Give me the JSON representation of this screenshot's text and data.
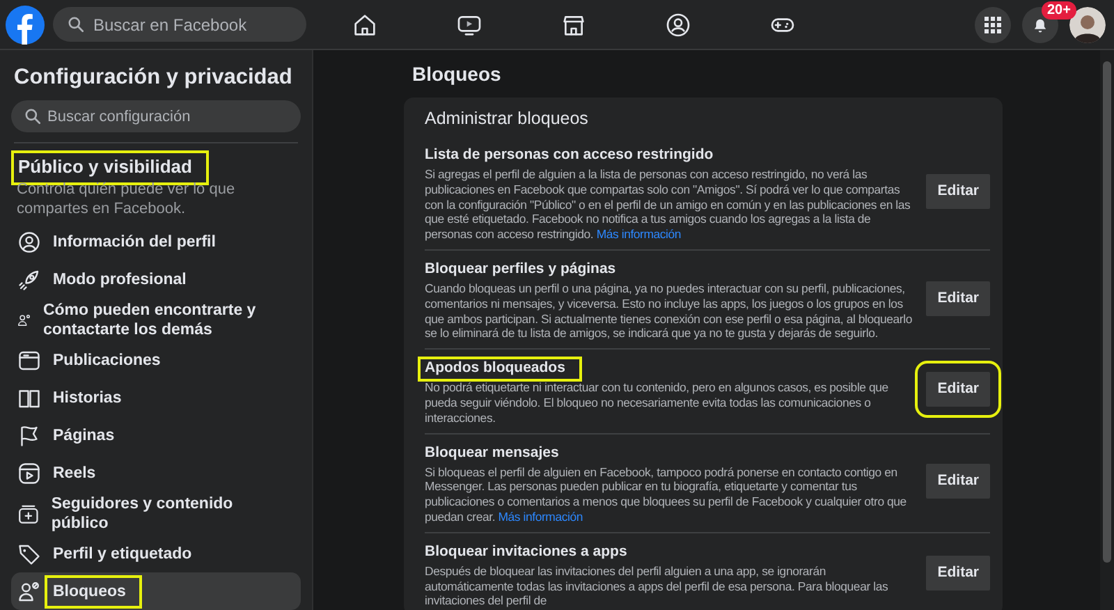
{
  "topbar": {
    "search": {
      "placeholder": "Buscar en Facebook"
    },
    "nav": [
      {
        "kind": "home"
      },
      {
        "kind": "video"
      },
      {
        "kind": "store"
      },
      {
        "kind": "groups"
      },
      {
        "kind": "gaming"
      }
    ],
    "notifications_badge": "20+"
  },
  "sidebar": {
    "title": "Configuración y privacidad",
    "search": {
      "placeholder": "Buscar configuración"
    },
    "section": {
      "title": "Público y visibilidad",
      "highlighted": true,
      "description": "Controla quién puede ver lo que compartes en Facebook."
    },
    "items": [
      {
        "label": "Información del perfil",
        "kind": "profile",
        "selected": false,
        "highlighted": false
      },
      {
        "label": "Modo profesional",
        "kind": "professional",
        "selected": false,
        "highlighted": false
      },
      {
        "label": "Cómo pueden encontrarte y contactarte los demás",
        "kind": "find",
        "selected": false,
        "highlighted": false
      },
      {
        "label": "Publicaciones",
        "kind": "posts",
        "selected": false,
        "highlighted": false
      },
      {
        "label": "Historias",
        "kind": "stories",
        "selected": false,
        "highlighted": false
      },
      {
        "label": "Páginas",
        "kind": "pages",
        "selected": false,
        "highlighted": false
      },
      {
        "label": "Reels",
        "kind": "reels",
        "selected": false,
        "highlighted": false
      },
      {
        "label": "Seguidores y contenido público",
        "kind": "followers",
        "selected": false,
        "highlighted": false
      },
      {
        "label": "Perfil y etiquetado",
        "kind": "tag",
        "selected": false,
        "highlighted": false
      },
      {
        "label": "Bloqueos",
        "kind": "block",
        "selected": true,
        "highlighted": true
      }
    ]
  },
  "main": {
    "title": "Bloqueos",
    "card": {
      "title": "Administrar bloqueos",
      "sections": [
        {
          "title": "Lista de personas con acceso restringido",
          "title_highlighted": false,
          "body": "Si agregas el perfil de alguien a la lista de personas con acceso restringido, no verá las publicaciones en Facebook que compartas solo con \"Amigos\". Sí podrá ver lo que compartas con la configuración \"Público\" o en el perfil de un amigo en común y en las publicaciones en las que esté etiquetado. Facebook no notifica a tus amigos cuando los agregas a la lista de personas con acceso restringido.",
          "link": "Más información",
          "button": "Editar",
          "button_highlighted": false
        },
        {
          "title": "Bloquear perfiles y páginas",
          "title_highlighted": false,
          "body": "Cuando bloqueas un perfil o una página, ya no puedes interactuar con su perfil, publicaciones, comentarios ni mensajes, y viceversa. Esto no incluye las apps, los juegos o los grupos en los que ambos participan. Si actualmente tienes conexión con ese perfil o esa página, al bloquearlo se lo eliminará de tu lista de amigos, se indicará que ya no te gusta y dejarás de seguirlo.",
          "button": "Editar",
          "button_highlighted": false
        },
        {
          "title": "Apodos bloqueados",
          "title_highlighted": true,
          "body": "No podrá etiquetarte ni interactuar con tu contenido, pero en algunos casos, es posible que pueda seguir viéndolo. El bloqueo no necesariamente evita todas las comunicaciones o interacciones.",
          "button": "Editar",
          "button_highlighted": true
        },
        {
          "title": "Bloquear mensajes",
          "title_highlighted": false,
          "body": "Si bloqueas el perfil de alguien en Facebook, tampoco podrá ponerse en contacto contigo en Messenger. Las personas pueden publicar en tu biografía, etiquetarte y comentar tus publicaciones o comentarios a menos que bloquees su perfil de Facebook y cualquier otro que puedan crear.",
          "link": "Más información",
          "button": "Editar",
          "button_highlighted": false
        },
        {
          "title": "Bloquear invitaciones a apps",
          "title_highlighted": false,
          "body": "Después de bloquear las invitaciones del perfil alguien a una app, se ignorarán automáticamente todas las invitaciones a apps del perfil de esa persona. Para bloquear las invitaciones del perfil de",
          "button": "Editar",
          "button_highlighted": false
        }
      ]
    }
  }
}
